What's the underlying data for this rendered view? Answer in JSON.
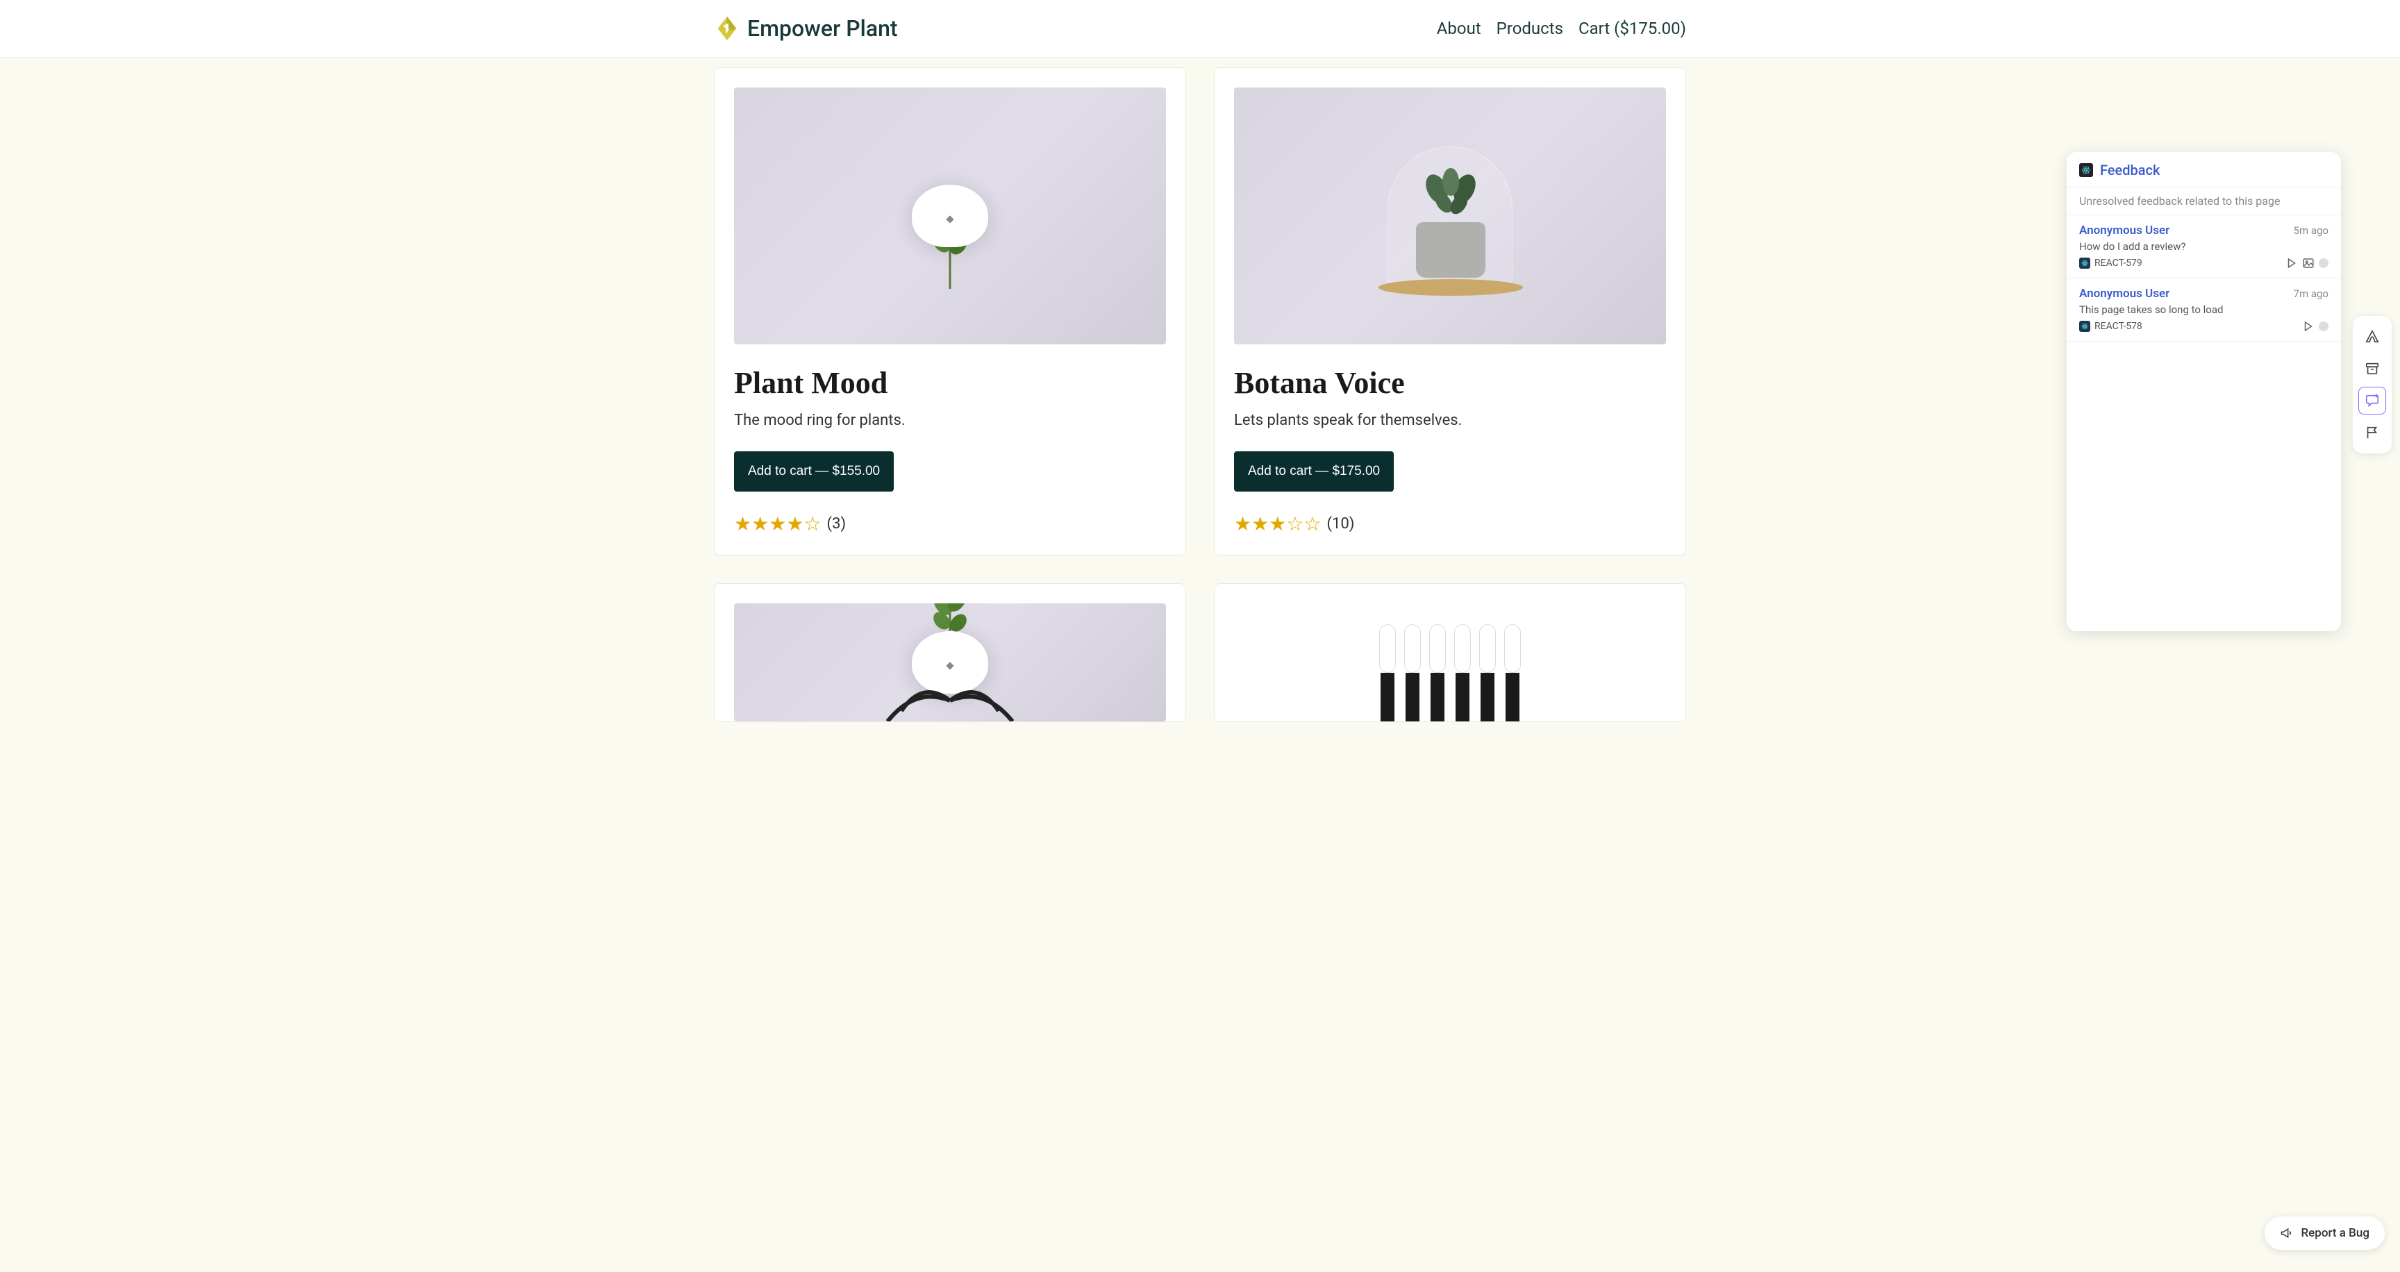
{
  "header": {
    "brand": "Empower Plant",
    "nav": {
      "about": "About",
      "products": "Products",
      "cart": "Cart ($175.00)"
    }
  },
  "products": [
    {
      "title": "Plant Mood",
      "description": "The mood ring for plants.",
      "cta": "Add to cart — $155.00",
      "rating_filled": 4,
      "rating_total": 5,
      "reviews": "(3)"
    },
    {
      "title": "Botana Voice",
      "description": "Lets plants speak for themselves.",
      "cta": "Add to cart — $175.00",
      "rating_filled": 3,
      "rating_total": 5,
      "reviews": "(10)"
    }
  ],
  "feedback": {
    "title": "Feedback",
    "subtitle": "Unresolved feedback related to this page",
    "items": [
      {
        "user": "Anonymous User",
        "time": "5m ago",
        "message": "How do I add a review?",
        "tag": "REACT-579",
        "has_image_icon": true
      },
      {
        "user": "Anonymous User",
        "time": "7m ago",
        "message": "This page takes so long to load",
        "tag": "REACT-578",
        "has_image_icon": false
      }
    ]
  },
  "report_bug": "Report a Bug"
}
